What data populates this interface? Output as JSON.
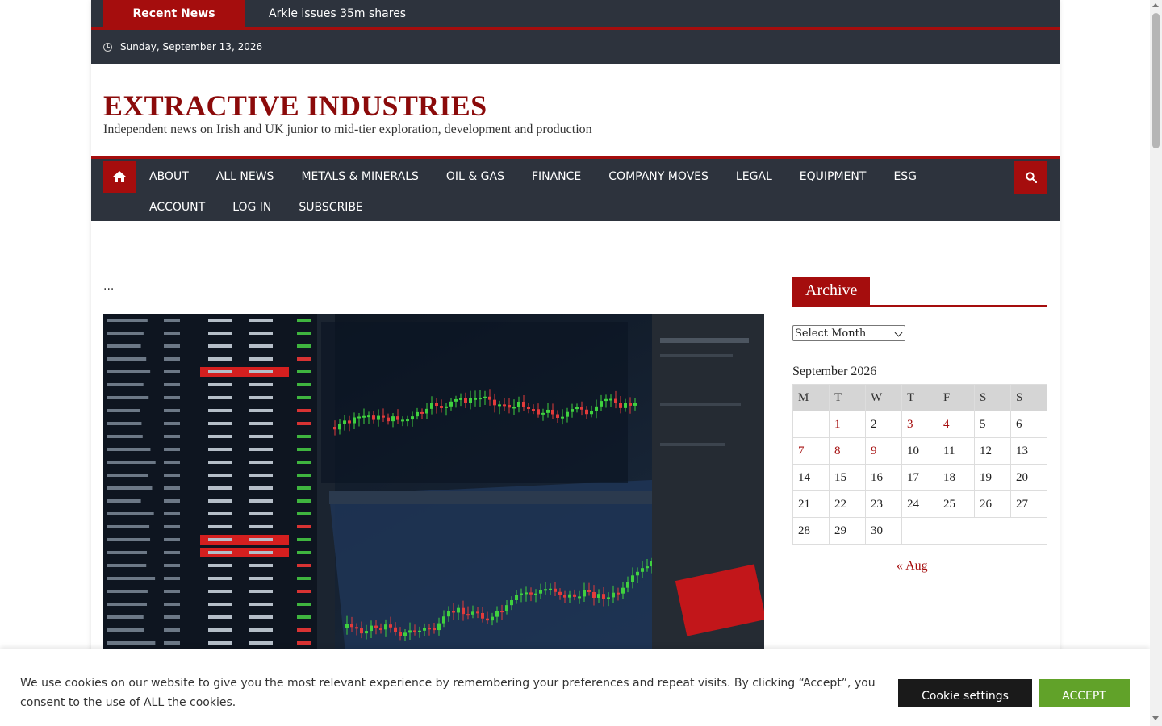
{
  "ticker": {
    "label": "Recent News",
    "headline": "Arkle issues 35m shares"
  },
  "datebar": {
    "icon": "clock-icon",
    "date": "Sunday, September 13, 2026"
  },
  "header": {
    "title": "EXTRACTIVE INDUSTRIES",
    "tagline": "Independent news on Irish and UK junior to mid-tier exploration, development and production"
  },
  "nav": {
    "home_icon": "home-icon",
    "search_icon": "search-icon",
    "row1": [
      "ABOUT",
      "ALL NEWS",
      "METALS & MINERALS",
      "OIL & GAS",
      "FINANCE",
      "COMPANY MOVES",
      "LEGAL",
      "EQUIPMENT",
      "ESG"
    ],
    "row2": [
      "ACCOUNT",
      "LOG IN",
      "SUBSCRIBE"
    ]
  },
  "main": {
    "ellipsis": "...",
    "hero_image": "stock-market-trading-screen-image"
  },
  "sidebar": {
    "archive_title": "Archive",
    "archive_select": "Select Month",
    "calendar": {
      "caption": "September 2026",
      "headers": [
        "M",
        "T",
        "W",
        "T",
        "F",
        "S",
        "S"
      ],
      "weeks": [
        [
          "",
          "1",
          "2",
          "3",
          "4",
          "5",
          "6"
        ],
        [
          "7",
          "8",
          "9",
          "10",
          "11",
          "12",
          "13"
        ],
        [
          "14",
          "15",
          "16",
          "17",
          "18",
          "19",
          "20"
        ],
        [
          "21",
          "22",
          "23",
          "24",
          "25",
          "26",
          "27"
        ],
        [
          "28",
          "29",
          "30",
          "",
          "",
          "",
          ""
        ]
      ],
      "linked_days": [
        "1",
        "3",
        "4",
        "7",
        "8",
        "9"
      ],
      "prev_link": "« Aug"
    }
  },
  "cookie": {
    "text": "We use cookies on our website to give you the most relevant experience by remembering your preferences and repeat visits. By clicking “Accept”, you consent to the use of ALL the cookies.",
    "settings_label": "Cookie settings",
    "accept_label": "ACCEPT"
  },
  "colors": {
    "accent": "#a50d0d",
    "title": "#8b0a0a",
    "dark_bar": "#2d333d",
    "accept": "#61a229"
  }
}
